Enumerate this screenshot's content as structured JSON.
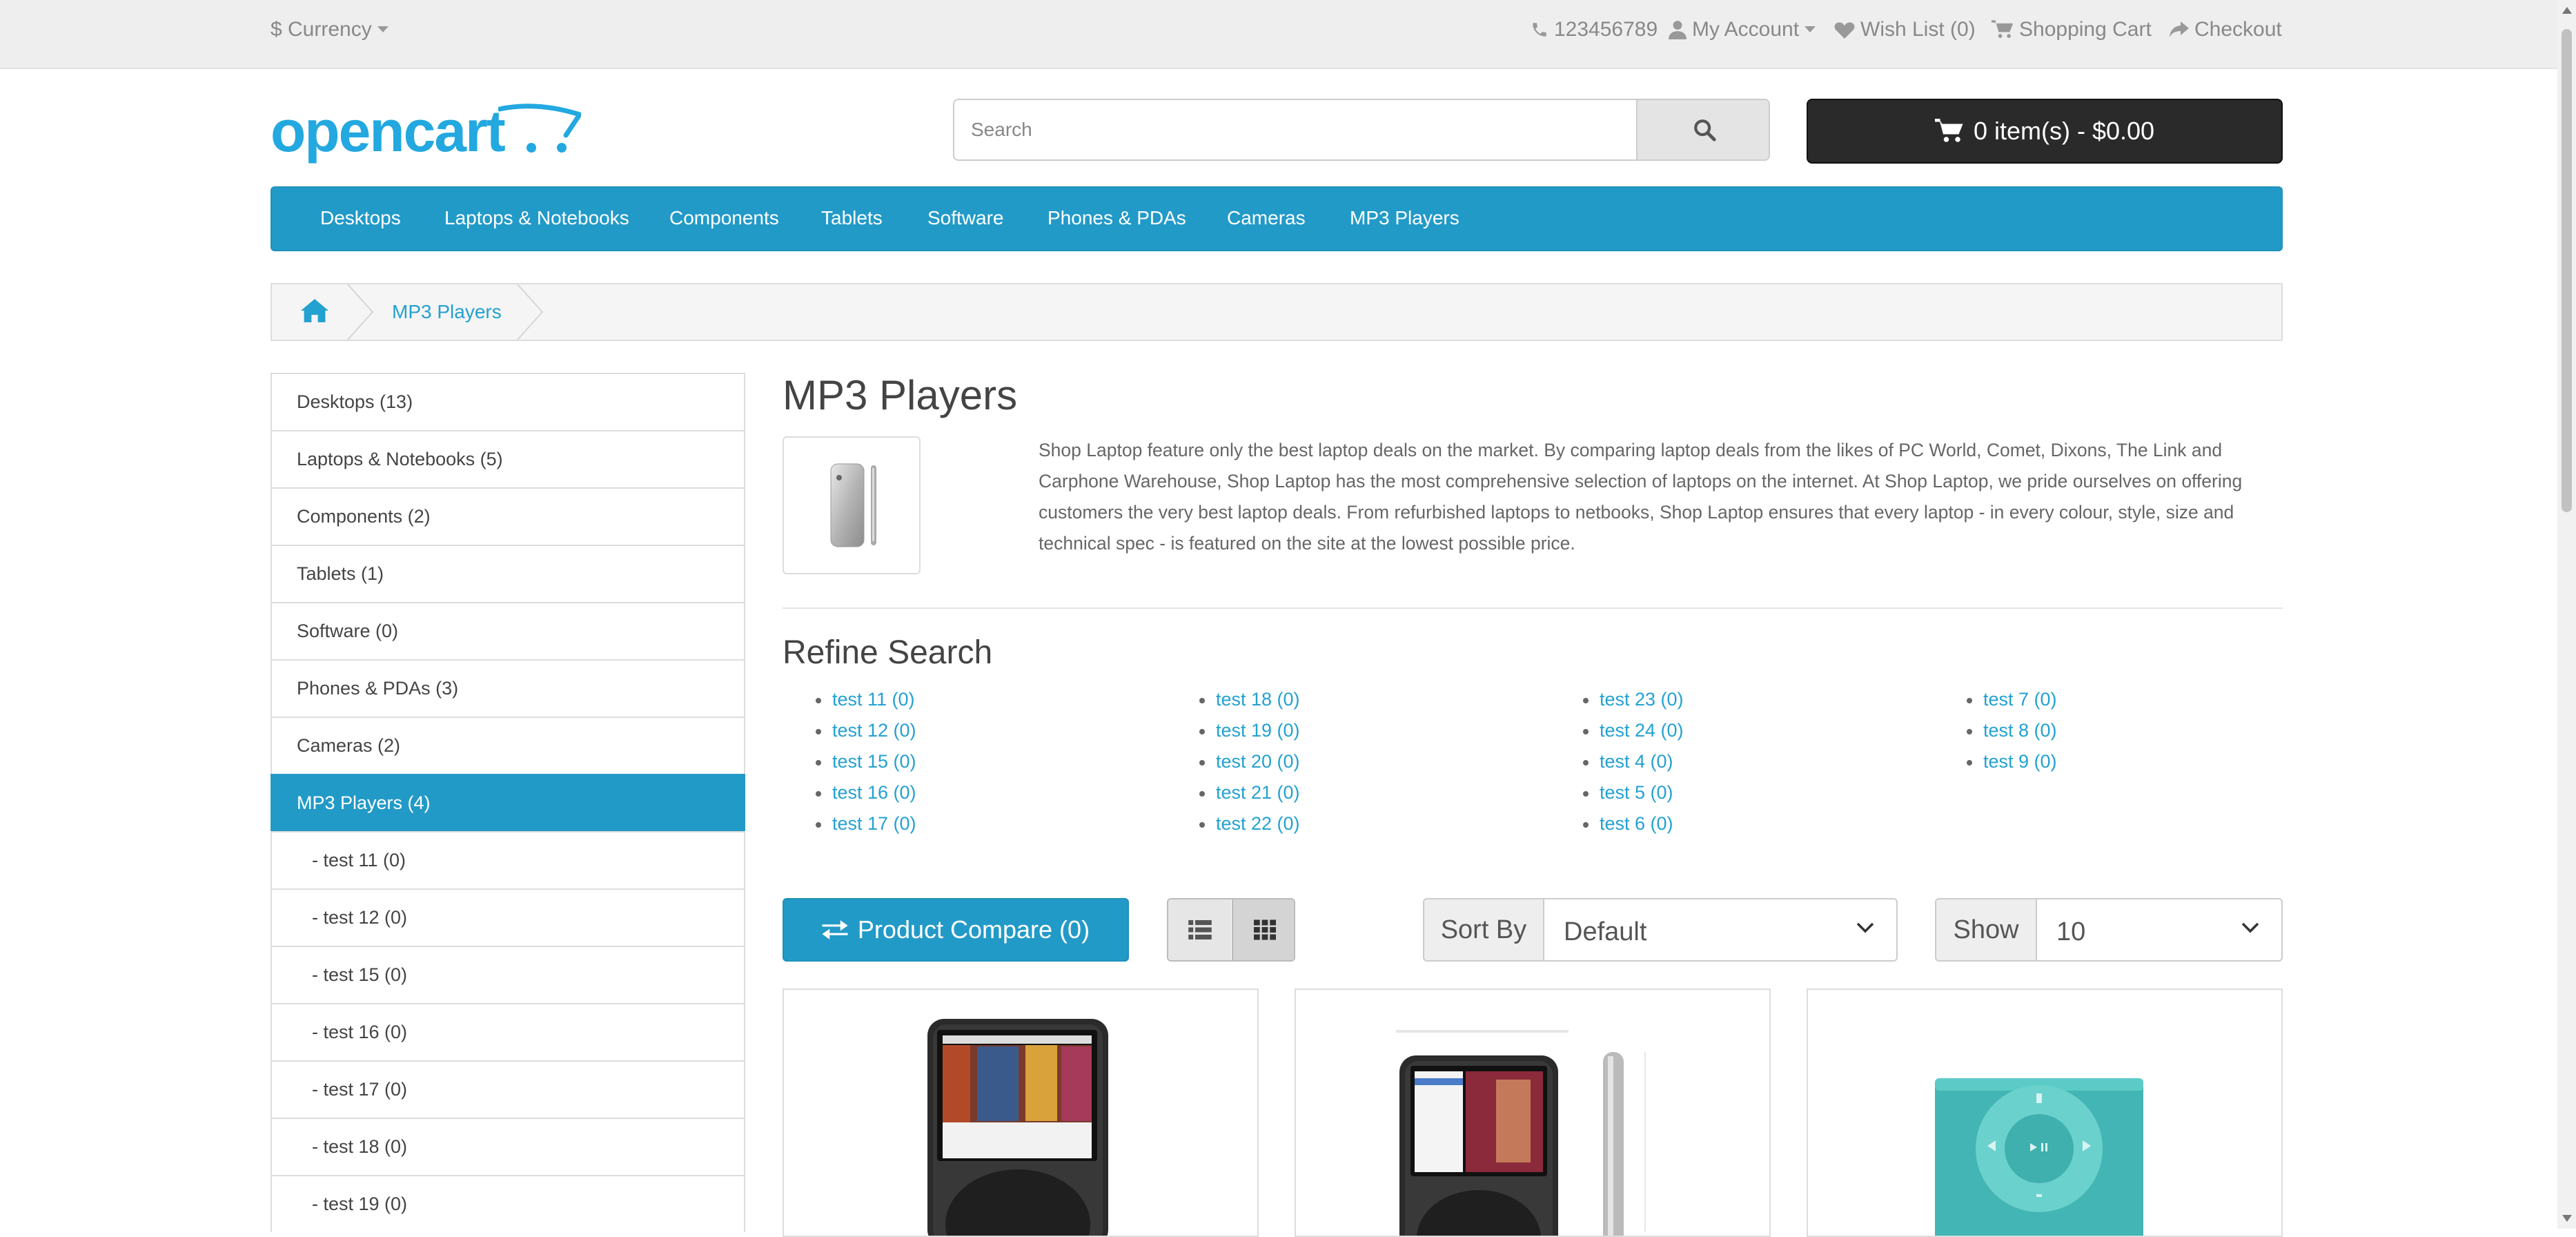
{
  "topbar": {
    "currency": "$ Currency",
    "phone": "123456789",
    "my_account": "My Account",
    "wishlist": "Wish List (0)",
    "shopping_cart": "Shopping Cart",
    "checkout": "Checkout"
  },
  "header": {
    "logo_text": "opencart",
    "search": {
      "placeholder": "Search",
      "value": ""
    },
    "cart_label": "0 item(s) - $0.00"
  },
  "menu": [
    "Desktops",
    "Laptops & Notebooks",
    "Components",
    "Tablets",
    "Software",
    "Phones & PDAs",
    "Cameras",
    "MP3 Players"
  ],
  "breadcrumb": {
    "current": "MP3 Players"
  },
  "sidebar": [
    "Desktops (13)",
    "Laptops & Notebooks (5)",
    "Components (2)",
    "Tablets (1)",
    "Software (0)",
    "Phones & PDAs (3)",
    "Cameras (2)",
    "MP3 Players (4)",
    "- test 11 (0)",
    "- test 12 (0)",
    "- test 15 (0)",
    "- test 16 (0)",
    "- test 17 (0)",
    "- test 18 (0)",
    "- test 19 (0)"
  ],
  "category": {
    "title": "MP3 Players",
    "description": "Shop Laptop feature only the best laptop deals on the market. By comparing laptop deals from the likes of PC World, Comet, Dixons, The Link and Carphone Warehouse, Shop Laptop has the most comprehensive selection of laptops on the internet. At Shop Laptop, we pride ourselves on offering customers the very best laptop deals. From refurbished laptops to netbooks, Shop Laptop ensures that every laptop - in every colour, style, size and technical spec - is featured on the site at the lowest possible price."
  },
  "refine": {
    "title": "Refine Search",
    "columns": [
      [
        "test 11 (0)",
        "test 12 (0)",
        "test 15 (0)",
        "test 16 (0)",
        "test 17 (0)"
      ],
      [
        "test 18 (0)",
        "test 19 (0)",
        "test 20 (0)",
        "test 21 (0)",
        "test 22 (0)"
      ],
      [
        "test 23 (0)",
        "test 24 (0)",
        "test 4 (0)",
        "test 5 (0)",
        "test 6 (0)"
      ],
      [
        "test 7 (0)",
        "test 8 (0)",
        "test 9 (0)"
      ]
    ]
  },
  "controls": {
    "compare": "Product Compare (0)",
    "sort_label": "Sort By",
    "sort_value": "Default",
    "show_label": "Show",
    "show_value": "10"
  },
  "colors": {
    "accent": "#229ac8",
    "link": "#23a1d1",
    "topbar": "#eeeeee",
    "cart_bg": "#2a2a2a"
  },
  "icons": [
    "phone-icon",
    "user-icon",
    "heart-icon",
    "cart-icon",
    "share-icon",
    "search-icon",
    "home-icon",
    "exchange-icon",
    "list-icon",
    "grid-icon",
    "caret-down-icon",
    "chevron-down-icon"
  ]
}
